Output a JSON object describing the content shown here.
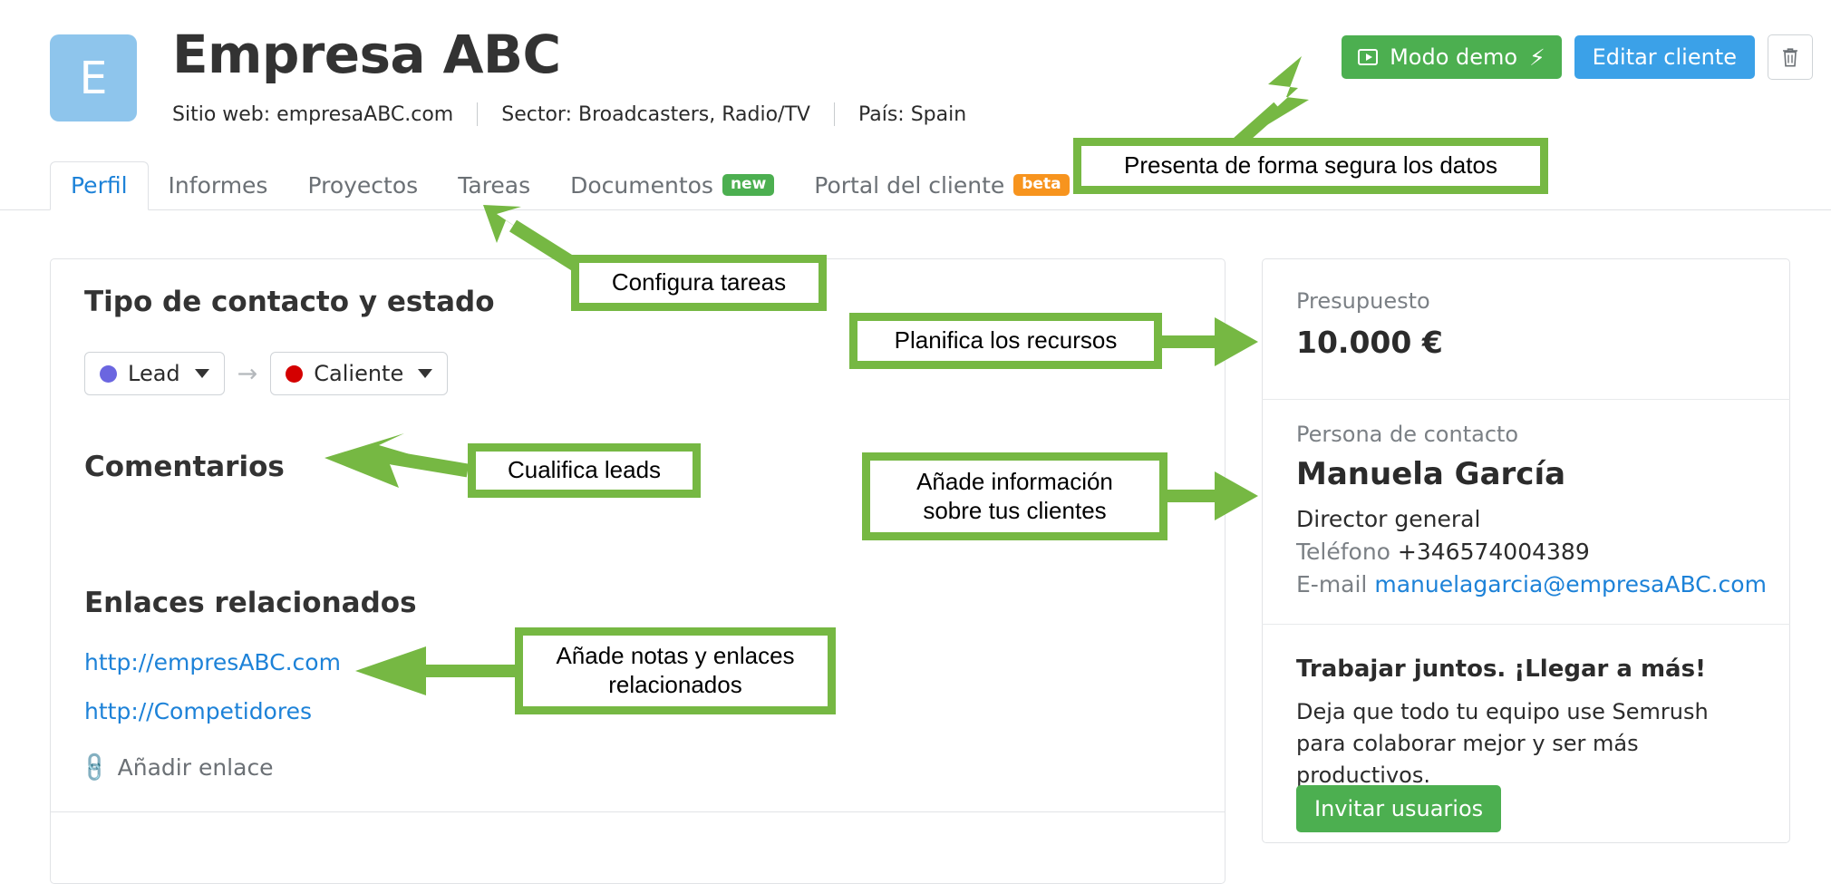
{
  "header": {
    "avatar_letter": "E",
    "title": "Empresa ABC",
    "meta": {
      "website": "Sitio web: empresaABC.com",
      "sector": "Sector: Broadcasters, Radio/TV",
      "country": "País: Spain"
    },
    "actions": {
      "demo_label": "Modo demo",
      "edit_label": "Editar cliente",
      "delete_label": "🗑"
    }
  },
  "tabs": [
    {
      "label": "Perfil",
      "active": true,
      "badge": ""
    },
    {
      "label": "Informes",
      "active": false,
      "badge": ""
    },
    {
      "label": "Proyectos",
      "active": false,
      "badge": ""
    },
    {
      "label": "Tareas",
      "active": false,
      "badge": ""
    },
    {
      "label": "Documentos",
      "active": false,
      "badge": "new"
    },
    {
      "label": "Portal del cliente",
      "active": false,
      "badge": "beta"
    }
  ],
  "main": {
    "contact_type_heading": "Tipo de contacto y estado",
    "type_select": {
      "value": "Lead",
      "dot_color": "#6b66e0"
    },
    "transition_arrow": "→",
    "status_select": {
      "value": "Caliente",
      "dot_color": "#d40000"
    },
    "comments_heading": "Comentarios",
    "links_heading": "Enlaces relacionados",
    "links": [
      "http://empresABC.com",
      "http://Competidores"
    ],
    "add_link_label": "Añadir enlace",
    "add_link_icon": "🔗"
  },
  "sidebar": {
    "budget_label": "Presupuesto",
    "budget_value": "10.000 €",
    "contact_label": "Persona de contacto",
    "contact_name": "Manuela García",
    "contact_role": "Director general",
    "phone_label": "Teléfono",
    "phone_value": "+346574004389",
    "email_label": "E-mail",
    "email_value": "manuelagarcia@empresaABC.com",
    "promo_title": "Trabajar juntos. ¡Llegar a más!",
    "promo_body": "Deja que todo tu equipo use Semrush para colaborar mejor y ser más productivos.",
    "promo_button": "Invitar usuarios"
  },
  "annotations": {
    "accent_color": "#76b843",
    "callouts": [
      {
        "id": "a1",
        "text": "Presenta de forma segura los datos"
      },
      {
        "id": "a2",
        "text": "Configura tareas"
      },
      {
        "id": "a3",
        "text": "Planifica los recursos"
      },
      {
        "id": "a4",
        "text": "Cualifica leads"
      },
      {
        "id": "a5",
        "text": "Añade información\nsobre tus clientes"
      },
      {
        "id": "a6",
        "text": "Añade notas y enlaces\nrelacionados"
      }
    ]
  },
  "colors": {
    "green": "#4caf50",
    "blue": "#3ba1e8",
    "link_blue": "#1d82d8",
    "orange": "#f7941e",
    "avatar_blue": "#8ec5ec",
    "annotation_green": "#76b843"
  }
}
